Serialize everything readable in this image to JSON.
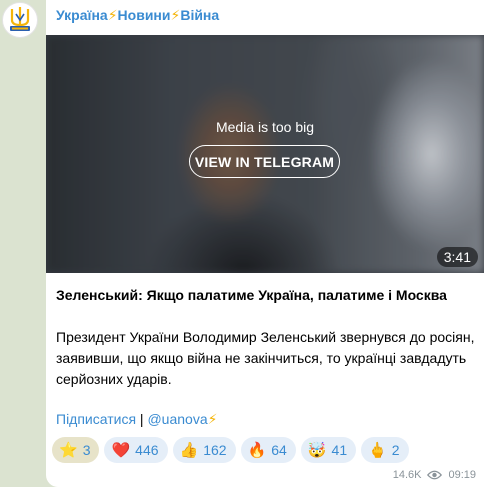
{
  "channel": {
    "title_parts": [
      "Україна",
      "⚡",
      "Новини",
      "⚡",
      "Війна"
    ]
  },
  "media": {
    "message": "Media is too big",
    "button_label": "VIEW IN TELEGRAM",
    "duration": "3:41"
  },
  "post": {
    "headline": "Зеленський: Якщо палатиме Україна, палатиме і Москва",
    "body": "Президент України Володимир Зеленський звернувся до росіян, заявивши, що якщо війна не закінчиться, то українці завдадуть серйозних ударів.",
    "subscribe_label": "Підписатися",
    "separator": " | ",
    "handle": "@uanova",
    "handle_bolt": "⚡"
  },
  "reactions": [
    {
      "emoji": "⭐",
      "count": "3"
    },
    {
      "emoji": "❤️",
      "count": "446"
    },
    {
      "emoji": "👍",
      "count": "162"
    },
    {
      "emoji": "🔥",
      "count": "64"
    },
    {
      "emoji": "🤯",
      "count": "41"
    },
    {
      "emoji": "🖕",
      "count": "2"
    }
  ],
  "meta": {
    "views": "14.6K",
    "time": "09:19"
  },
  "colors": {
    "accent": "#3a8bd1",
    "bolt": "#f5b50a",
    "background": "#dbe3d0"
  }
}
